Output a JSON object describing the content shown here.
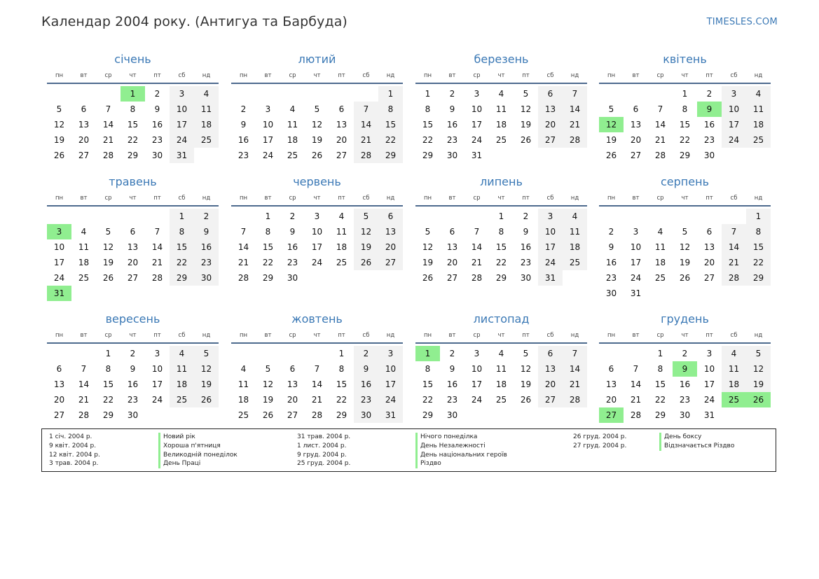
{
  "title": "Календар 2004 року. (Антигуа та Барбуда)",
  "site": "TIMESLES.COM",
  "colors": {
    "accent": "#3a78b5",
    "holiday": "#90ee90",
    "weekend": "#f2f2f2",
    "rule": "#4d6a8e"
  },
  "weekdays": [
    "пн",
    "вт",
    "ср",
    "чт",
    "пт",
    "сб",
    "нд"
  ],
  "months": [
    {
      "name": "січень",
      "offset": 3,
      "days": 31,
      "holidays": [
        1
      ]
    },
    {
      "name": "лютий",
      "offset": 6,
      "days": 29,
      "holidays": []
    },
    {
      "name": "березень",
      "offset": 0,
      "days": 31,
      "holidays": []
    },
    {
      "name": "квітень",
      "offset": 3,
      "days": 30,
      "holidays": [
        9,
        12
      ]
    },
    {
      "name": "травень",
      "offset": 5,
      "days": 31,
      "holidays": [
        3,
        31
      ]
    },
    {
      "name": "червень",
      "offset": 1,
      "days": 30,
      "holidays": []
    },
    {
      "name": "липень",
      "offset": 3,
      "days": 31,
      "holidays": []
    },
    {
      "name": "серпень",
      "offset": 6,
      "days": 31,
      "holidays": []
    },
    {
      "name": "вересень",
      "offset": 2,
      "days": 30,
      "holidays": []
    },
    {
      "name": "жовтень",
      "offset": 4,
      "days": 31,
      "holidays": []
    },
    {
      "name": "листопад",
      "offset": 0,
      "days": 30,
      "holidays": [
        1
      ]
    },
    {
      "name": "грудень",
      "offset": 2,
      "days": 31,
      "holidays": [
        9,
        25,
        26,
        27
      ]
    }
  ],
  "legend": [
    {
      "dates": [
        "1 січ. 2004 р.",
        "9 квіт. 2004 р.",
        "12 квіт. 2004 р.",
        "3 трав. 2004 р."
      ],
      "names": [
        "Новий рік",
        "Хороша п'ятниця",
        "Великодній понеділок",
        "День Праці"
      ]
    },
    {
      "dates": [
        "31 трав. 2004 р.",
        "1 лист. 2004 р.",
        "9 груд. 2004 р.",
        "25 груд. 2004 р."
      ],
      "names": [
        "Нічого понеділка",
        "День Незалежності",
        "День національних героїв",
        "Різдво"
      ]
    },
    {
      "dates": [
        "26 груд. 2004 р.",
        "27 груд. 2004 р."
      ],
      "names": [
        "День боксу",
        "Відзначається Різдво"
      ]
    }
  ]
}
